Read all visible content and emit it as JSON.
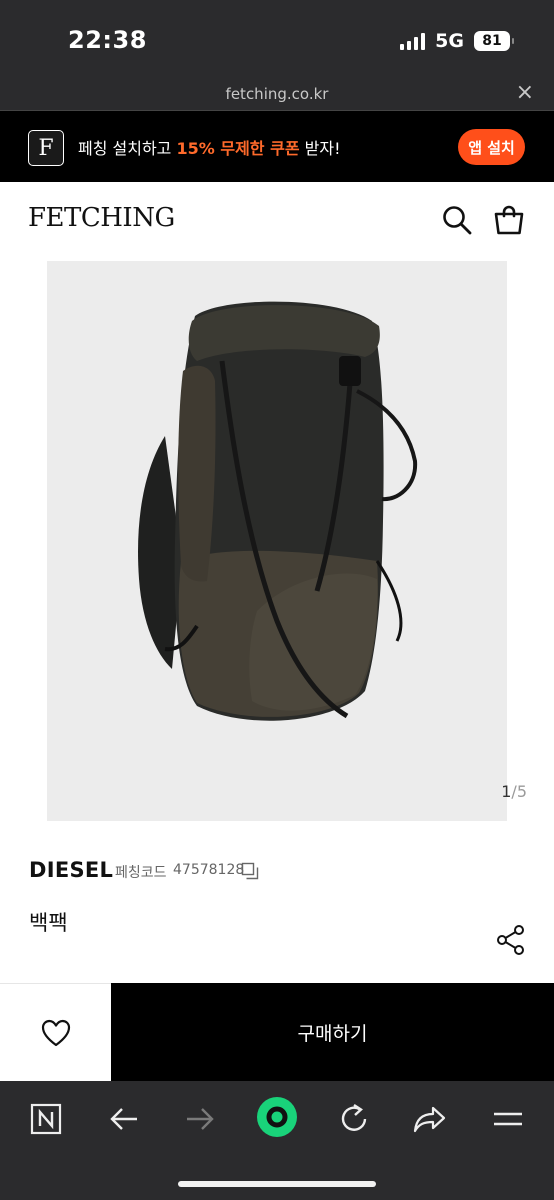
{
  "status_bar": {
    "time": "22:38",
    "network": "5G",
    "battery": "81"
  },
  "browser": {
    "url": "fetching.co.kr",
    "close_symbol": "×"
  },
  "promo": {
    "logo_letter": "F",
    "text_before": "페칭 설치하고 ",
    "highlight": "15% 무제한 쿠폰",
    "text_after": " 받자!",
    "install_label": "앱 설치",
    "accent_color": "#ff4f1a"
  },
  "header": {
    "logo": "FETCHING",
    "icons": [
      "search-icon",
      "shopping-bag-icon"
    ]
  },
  "gallery": {
    "current": "1",
    "separator": "/",
    "total": "5"
  },
  "product": {
    "brand": "DIESEL",
    "code_label": "페칭코드",
    "code": "47578128",
    "name": "백팩",
    "icons": [
      "copy-icon",
      "share-icon"
    ]
  },
  "purchase": {
    "buy_label": "구매하기",
    "wish_icon": "heart-icon"
  },
  "toolbar": {
    "icons": [
      "n-logo-icon",
      "back-arrow-icon",
      "forward-arrow-icon",
      "home-circle-icon",
      "reload-icon",
      "share-arrow-icon",
      "menu-icon"
    ]
  }
}
